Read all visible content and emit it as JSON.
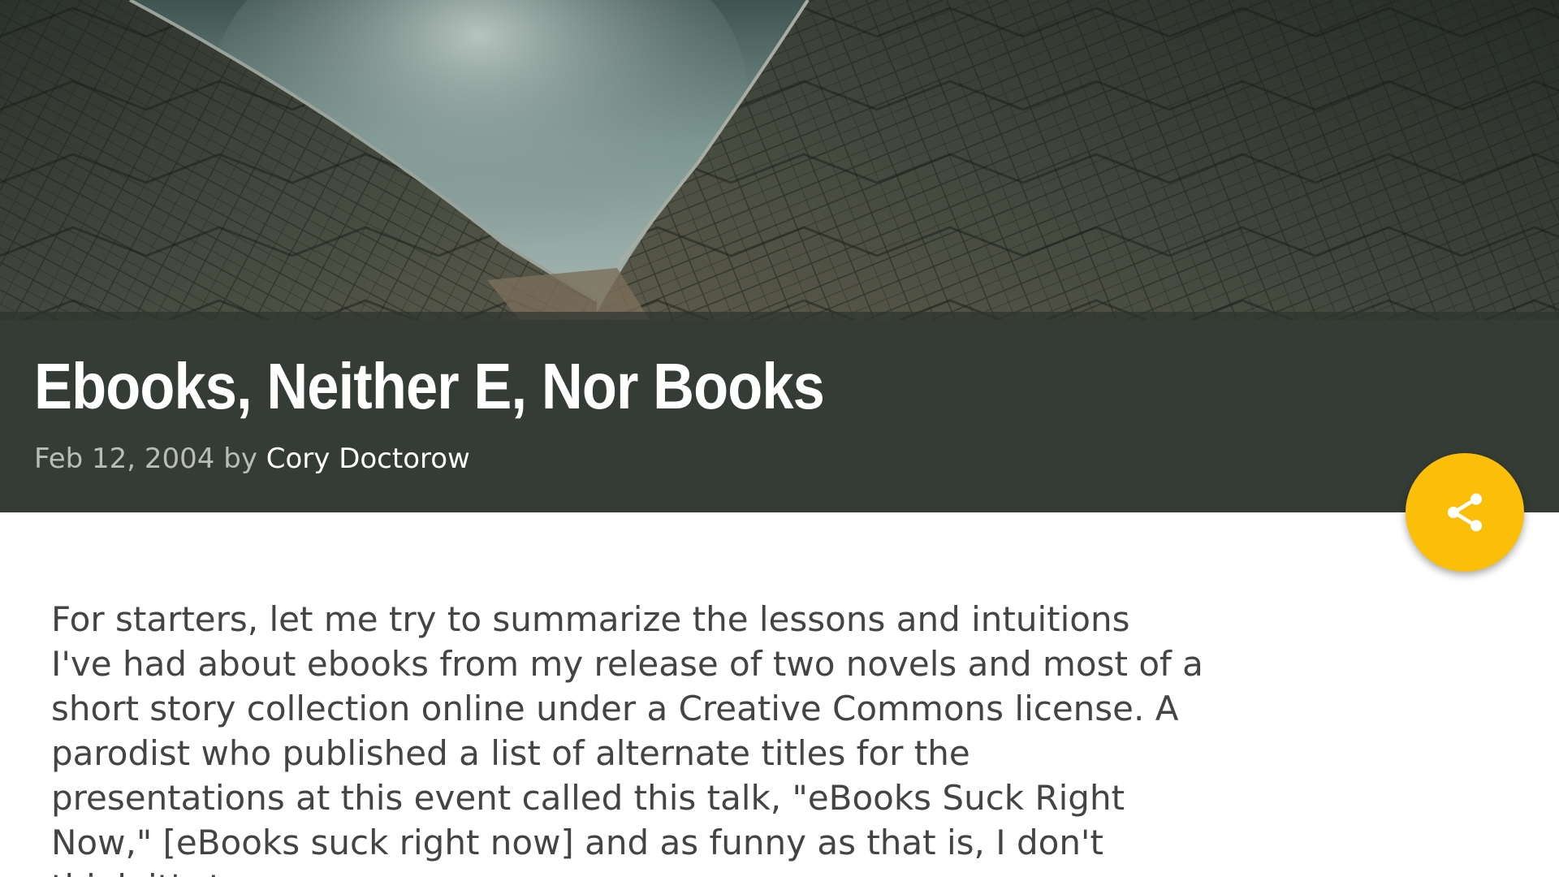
{
  "post": {
    "title": "Ebooks, Neither E, Nor Books",
    "date": "Feb 12, 2004",
    "by": "by",
    "author": "Cory Doctorow",
    "body_lines": [
      "For starters, let me try to summarize the lessons and intuitions",
      "I've had about ebooks from my release of two novels and most of a",
      "short story collection online under a Creative Commons license. A",
      "parodist who published a list of alternate titles for the",
      "presentations at this event called this talk, \"eBooks Suck Right",
      "Now,\" [eBooks suck right now] and as funny as that is, I don't",
      "think it's true."
    ]
  },
  "share": {
    "icon": "share-icon",
    "color": "#fbbf0a"
  },
  "colors": {
    "banner": "#353c35",
    "title_text": "#ffffff",
    "meta_text": "#b9bdb8",
    "body_text": "#444444"
  }
}
